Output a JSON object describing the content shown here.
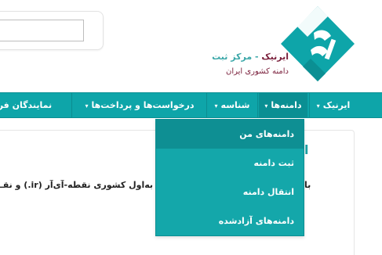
{
  "header": {
    "search": {
      "value": "",
      "placeholder": ""
    },
    "logo": {
      "brand": "ایرنیک",
      "tagline_1": " - مرکز ثبت",
      "tagline_2": "دامنه کشوری ایران",
      "colors": {
        "teal": "#0ea5a9",
        "maroon": "#7a1f3b"
      }
    }
  },
  "nav": {
    "items": [
      {
        "label": "ایرنیک",
        "has_dropdown": true
      },
      {
        "label": "دامنه‌ها",
        "has_dropdown": true,
        "active": true
      },
      {
        "label": "شناسه",
        "has_dropdown": true
      },
      {
        "label": "درخواست‌ها و پرداخت‌ها",
        "has_dropdown": true
      },
      {
        "label": "نمایندگان فرو"
      }
    ],
    "caret_icon": "▾",
    "bar_color": "#0ea5a9"
  },
  "dropdown": {
    "items": [
      {
        "label": "دامنه‌های من",
        "highlighted": true
      },
      {
        "label": "ثبت دامنه"
      },
      {
        "label": "انتقال دامنه"
      },
      {
        "label": "دامنه‌های آزادشده"
      }
    ]
  },
  "content": {
    "heading_fragment": "ا",
    "text": "به‌اول کشوری نقطه-آی‌آر (ir.) و نقـ",
    "text_fragment": "با"
  }
}
